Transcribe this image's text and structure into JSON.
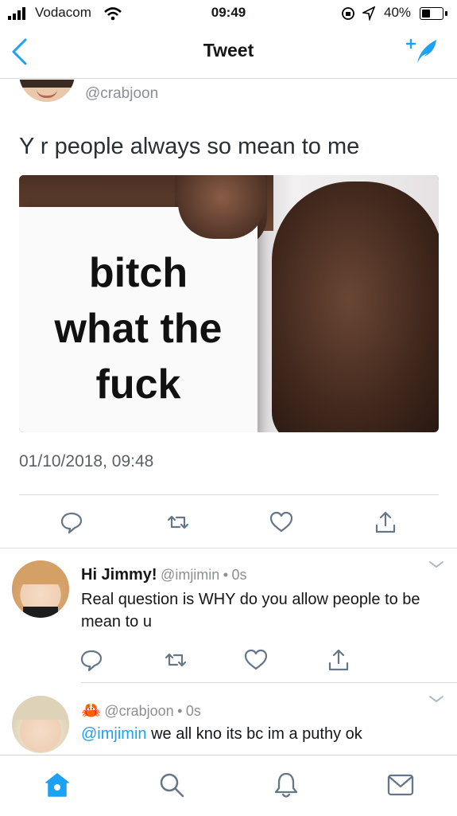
{
  "status_bar": {
    "carrier": "Vodacom",
    "time": "09:49",
    "battery_percent": "40%",
    "battery_level": 0.4
  },
  "nav": {
    "title": "Tweet"
  },
  "main_tweet": {
    "handle": "@crabjoon",
    "text": "Y r people always so mean to me",
    "image_caption": [
      "bitch",
      "what the",
      "fuck"
    ],
    "timestamp": "01/10/2018, 09:48"
  },
  "replies": [
    {
      "name": "Hi Jimmy!",
      "handle": "@imjimin",
      "sep": "•",
      "time": "0s",
      "text": "Real question is WHY do you allow people to be mean to u"
    },
    {
      "name_emoji": "🦀",
      "handle": "@crabjoon",
      "sep": "•",
      "time": "0s",
      "mention": "@imjimin",
      "text": " we all kno its bc im a puthy ok"
    }
  ],
  "colors": {
    "accent": "#1da1f2",
    "text": "#14171a",
    "muted": "#8a8f95"
  },
  "icons": [
    "back-chevron-icon",
    "compose-tweet-icon",
    "reply-icon",
    "retweet-icon",
    "like-icon",
    "share-icon",
    "home-icon",
    "search-icon",
    "notifications-icon",
    "messages-icon",
    "caret-down-icon"
  ]
}
